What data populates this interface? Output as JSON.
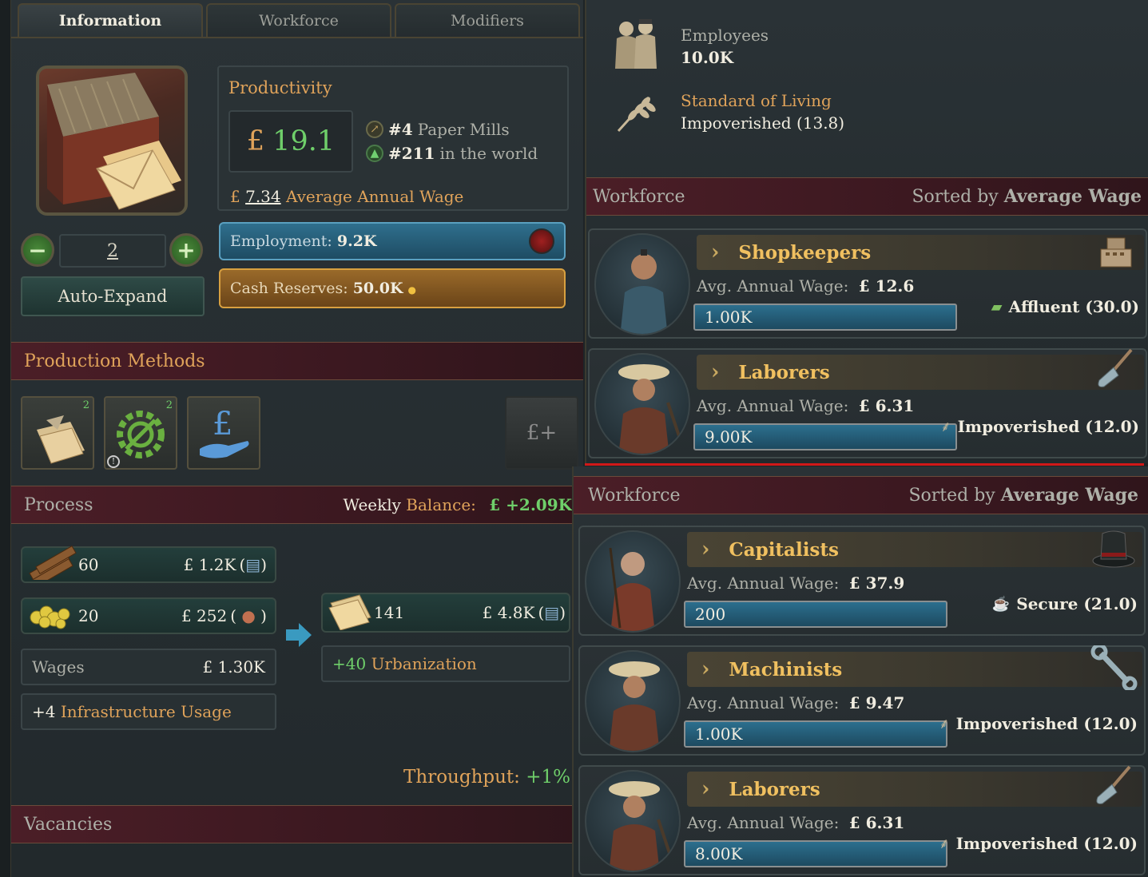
{
  "tabs": [
    "Information",
    "Workforce",
    "Modifiers"
  ],
  "building": {
    "level": "2",
    "auto_expand": "Auto-Expand"
  },
  "productivity": {
    "title": "Productivity",
    "currency": "£",
    "value": "19.1",
    "rank_country_num": "#4",
    "rank_country_label": "Paper Mills",
    "rank_world_num": "#211",
    "rank_world_label": "in the world",
    "wage_value": "7.34",
    "wage_label": "Average Annual Wage"
  },
  "employment": {
    "label": "Employment:",
    "value": "9.2K"
  },
  "cash_reserves": {
    "label": "Cash Reserves:",
    "value": "50.0K"
  },
  "production_methods": {
    "title": "Production Methods",
    "badge1": "2",
    "badge2": "2"
  },
  "process": {
    "title": "Process",
    "balance_label1": "Weekly",
    "balance_label2": "Balance:",
    "balance_value": "£ +2.09K",
    "inputs": [
      {
        "qty": "60",
        "cost": "£ 1.2K"
      },
      {
        "qty": "20",
        "cost": "£ 252"
      }
    ],
    "output": {
      "qty": "141",
      "value": "£ 4.8K"
    },
    "wages_label": "Wages",
    "wages_value": "£ 1.30K",
    "infra_num": "+4",
    "infra_label": "Infrastructure Usage",
    "urban_num": "+40",
    "urban_label": "Urbanization",
    "throughput_label": "Throughput:",
    "throughput_value": "+1%"
  },
  "vacancies": "Vacancies",
  "employees": {
    "label": "Employees",
    "value": "10.0K"
  },
  "standard_of_living": {
    "label": "Standard of Living",
    "value": "Impoverished (13.8)"
  },
  "workforce_top": {
    "title": "Workforce",
    "sorted_prefix": "Sorted by",
    "sorted_value": "Average Wage",
    "pops": [
      {
        "name": "Shopkeepers",
        "wage_label": "Avg. Annual Wage:",
        "wage": "£ 12.6",
        "count": "1.00K",
        "sol": "Affluent (30.0)"
      },
      {
        "name": "Laborers",
        "wage_label": "Avg. Annual Wage:",
        "wage": "£ 6.31",
        "count": "9.00K",
        "sol": "Impoverished (12.0)"
      }
    ]
  },
  "workforce_bottom": {
    "title": "Workforce",
    "sorted_prefix": "Sorted by",
    "sorted_value": "Average Wage",
    "pops": [
      {
        "name": "Capitalists",
        "wage_label": "Avg. Annual Wage:",
        "wage": "£ 37.9",
        "count": "200",
        "sol": "Secure (21.0)"
      },
      {
        "name": "Machinists",
        "wage_label": "Avg. Annual Wage:",
        "wage": "£ 9.47",
        "count": "1.00K",
        "sol": "Impoverished (12.0)"
      },
      {
        "name": "Laborers",
        "wage_label": "Avg. Annual Wage:",
        "wage": "£ 6.31",
        "count": "8.00K",
        "sol": "Impoverished (12.0)"
      }
    ]
  },
  "colors": {
    "gold": "#e0a35a",
    "green": "#6fcf6a",
    "separator": "#d01818",
    "bar_blue": "#2c6f8e"
  },
  "icons": [
    "employees-icon",
    "wheat-icon",
    "cash-register-icon",
    "shovel-icon",
    "top-hat-icon",
    "wrench-icon",
    "teacup-icon",
    "money-icon",
    "logs-icon",
    "gold-ore-icon",
    "paper-icon",
    "pound-hand-icon",
    "gear-icon",
    "plus-icon",
    "minus-icon"
  ]
}
